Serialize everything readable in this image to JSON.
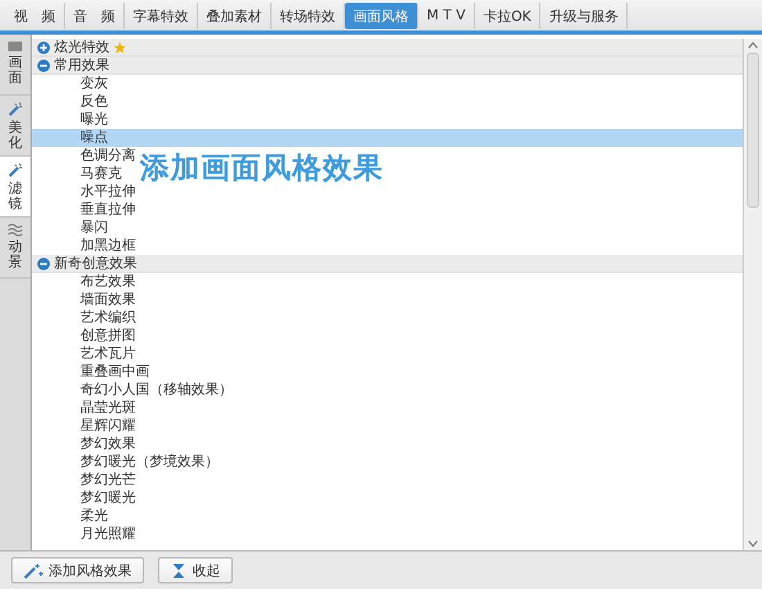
{
  "top_tabs": [
    {
      "label": "视　频",
      "selected": false
    },
    {
      "label": "音　频",
      "selected": false
    },
    {
      "label": "字幕特效",
      "selected": false
    },
    {
      "label": "叠加素材",
      "selected": false
    },
    {
      "label": "转场特效",
      "selected": false
    },
    {
      "label": "画面风格",
      "selected": true
    },
    {
      "label": "M T V",
      "selected": false
    },
    {
      "label": "卡拉OK",
      "selected": false
    },
    {
      "label": "升级与服务",
      "selected": false
    }
  ],
  "side_tabs": [
    {
      "label": "画面",
      "selected": false
    },
    {
      "label": "美化",
      "selected": false
    },
    {
      "label": "滤镜",
      "selected": true
    },
    {
      "label": "动景",
      "selected": false
    }
  ],
  "effect_groups": [
    {
      "label": "炫光特效",
      "expanded": false,
      "starred": true
    },
    {
      "label": "常用效果",
      "expanded": true,
      "starred": false,
      "children": [
        {
          "label": "变灰",
          "selected": false
        },
        {
          "label": "反色",
          "selected": false
        },
        {
          "label": "曝光",
          "selected": false
        },
        {
          "label": "噪点",
          "selected": true
        },
        {
          "label": "色调分离",
          "selected": false
        },
        {
          "label": "马赛克",
          "selected": false
        },
        {
          "label": "水平拉伸",
          "selected": false
        },
        {
          "label": "垂直拉伸",
          "selected": false
        },
        {
          "label": "暴闪",
          "selected": false
        },
        {
          "label": "加黑边框",
          "selected": false
        }
      ]
    },
    {
      "label": "新奇创意效果",
      "expanded": true,
      "starred": false,
      "children": [
        {
          "label": "布艺效果",
          "selected": false
        },
        {
          "label": "墙面效果",
          "selected": false
        },
        {
          "label": "艺术编织",
          "selected": false
        },
        {
          "label": "创意拼图",
          "selected": false
        },
        {
          "label": "艺术瓦片",
          "selected": false
        },
        {
          "label": "重叠画中画",
          "selected": false
        },
        {
          "label": "奇幻小人国（移轴效果）",
          "selected": false
        },
        {
          "label": "晶莹光斑",
          "selected": false
        },
        {
          "label": "星辉闪耀",
          "selected": false
        },
        {
          "label": "梦幻效果",
          "selected": false
        },
        {
          "label": "梦幻暖光（梦境效果）",
          "selected": false
        },
        {
          "label": "梦幻光芒",
          "selected": false
        },
        {
          "label": "梦幻暖光",
          "selected": false
        },
        {
          "label": "柔光",
          "selected": false
        },
        {
          "label": "月光照耀",
          "selected": false
        }
      ]
    }
  ],
  "overlay_caption": "添加画面风格效果",
  "buttons": [
    {
      "label": "添加风格效果"
    },
    {
      "label": "收起"
    }
  ]
}
